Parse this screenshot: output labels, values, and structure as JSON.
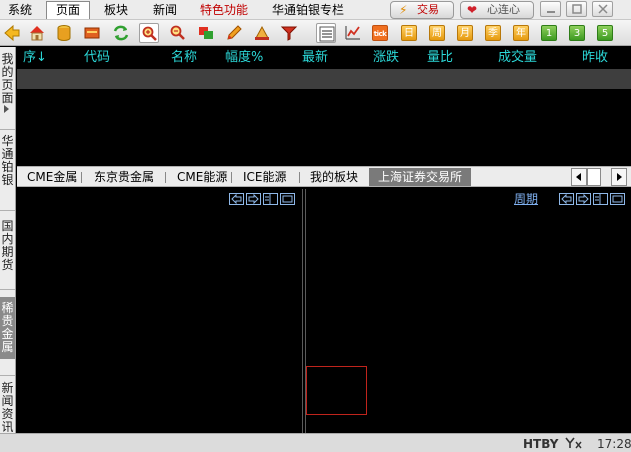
{
  "menu": {
    "items": [
      {
        "id": "system",
        "label": "系统"
      },
      {
        "id": "page",
        "label": "页面",
        "active": true
      },
      {
        "id": "block",
        "label": "板块"
      },
      {
        "id": "news",
        "label": "新闻"
      },
      {
        "id": "special",
        "label": "特色功能",
        "color": "#c00000"
      },
      {
        "id": "column",
        "label": "华通铂银专栏"
      }
    ],
    "trade_button": "交易",
    "connect_button": "心连心"
  },
  "toolbar": {
    "icons": [
      "back-arrow-icon",
      "home-icon",
      "database-icon",
      "card-icon",
      "refresh-icon",
      "zoom-in-icon",
      "zoom-out-icon",
      "windows-icon",
      "pencil-icon",
      "tools-icon",
      "filter-icon",
      "quote-list-icon",
      "trend-chart-icon"
    ],
    "tick_label": "tick",
    "period_buttons": [
      "日",
      "周",
      "月",
      "季",
      "年"
    ],
    "number_buttons": [
      "1",
      "3",
      "5"
    ],
    "colors": {
      "green": "#3d9a22",
      "orange": "#e59a10",
      "tick": "#f07020"
    }
  },
  "left_tabs": [
    "我的页面",
    "华通铂银",
    "国内期货",
    "稀贵金属",
    "新闻资讯"
  ],
  "quote_table": {
    "columns": [
      "序",
      "代码",
      "名称",
      "幅度%",
      "最新",
      "涨跌",
      "量比",
      "成交量",
      "昨收"
    ],
    "sort_indicator": "↓",
    "header_color": "#2bd7d7",
    "rows": []
  },
  "market_tabs": {
    "items": [
      "CME金属",
      "东京贵金属",
      "CME能源",
      "ICE能源",
      "我的板块",
      "上海证券交易所"
    ],
    "active_index": 5
  },
  "chart_panes": {
    "right_period_label": "周期"
  },
  "status": {
    "broker": "HTBY",
    "clock": "17:28"
  }
}
